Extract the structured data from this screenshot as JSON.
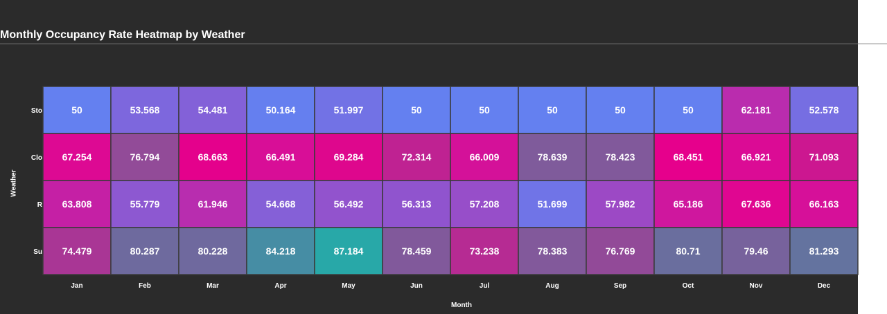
{
  "title": "Monthly Occupancy Rate Heatmap by Weather",
  "chart_data": {
    "type": "heatmap",
    "xlabel": "Month",
    "ylabel": "Weather",
    "months": [
      "Jan",
      "Feb",
      "Mar",
      "Apr",
      "May",
      "Jun",
      "Jul",
      "Aug",
      "Sep",
      "Oct",
      "Nov",
      "Dec"
    ],
    "weather": [
      "Sto",
      "Clo",
      "R",
      "Su"
    ],
    "values": [
      [
        50,
        53.568,
        54.481,
        50.164,
        51.997,
        50,
        50,
        50,
        50,
        50,
        62.181,
        52.578
      ],
      [
        67.254,
        76.794,
        68.663,
        66.491,
        69.284,
        72.314,
        66.009,
        78.639,
        78.423,
        68.451,
        66.921,
        71.093
      ],
      [
        63.808,
        55.779,
        61.946,
        54.668,
        56.492,
        56.313,
        57.208,
        51.699,
        57.982,
        65.186,
        67.636,
        66.163
      ],
      [
        74.479,
        80.287,
        80.228,
        84.218,
        87.184,
        78.459,
        73.238,
        78.383,
        76.769,
        80.71,
        79.46,
        81.293
      ]
    ],
    "colors": [
      "#6480F0",
      "#E6008C",
      "#28A8A8"
    ]
  }
}
